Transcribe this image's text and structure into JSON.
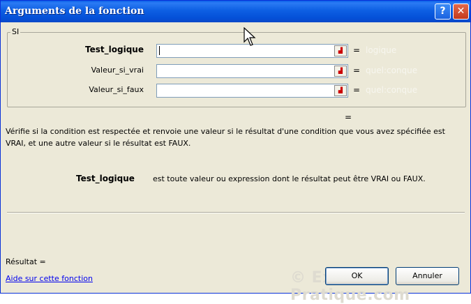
{
  "window": {
    "title": "Arguments de la fonction",
    "help_glyph": "?",
    "close_glyph": "✕"
  },
  "function": {
    "name": "SI",
    "args": [
      {
        "label": "Test_logique",
        "type_hint": "logique",
        "bold": true
      },
      {
        "label": "Valeur_si_vrai",
        "type_hint": "quel:conque",
        "bold": false
      },
      {
        "label": "Valeur_si_faux",
        "type_hint": "quel:conque",
        "bold": false
      }
    ],
    "equals": "=",
    "result_equals": "="
  },
  "description": "Vérifie si la condition est respectée et renvoie une valeur si le résultat d'une condition que vous avez spécifiée est VRAI, et une autre valeur si le résultat est FAUX.",
  "param_help": {
    "name": "Test_logique",
    "text": "est toute valeur ou expression dont le résultat peut être VRAI ou FAUX."
  },
  "result": {
    "label": "Résultat ="
  },
  "help_link": "Aide sur cette fonction",
  "watermark": "© Excel-Pratique.com",
  "buttons": {
    "ok": "OK",
    "cancel": "Annuler"
  },
  "colors": {
    "titlebar": "#0a5fe8",
    "dialog_bg": "#ece9d8",
    "link": "#0000ee"
  }
}
